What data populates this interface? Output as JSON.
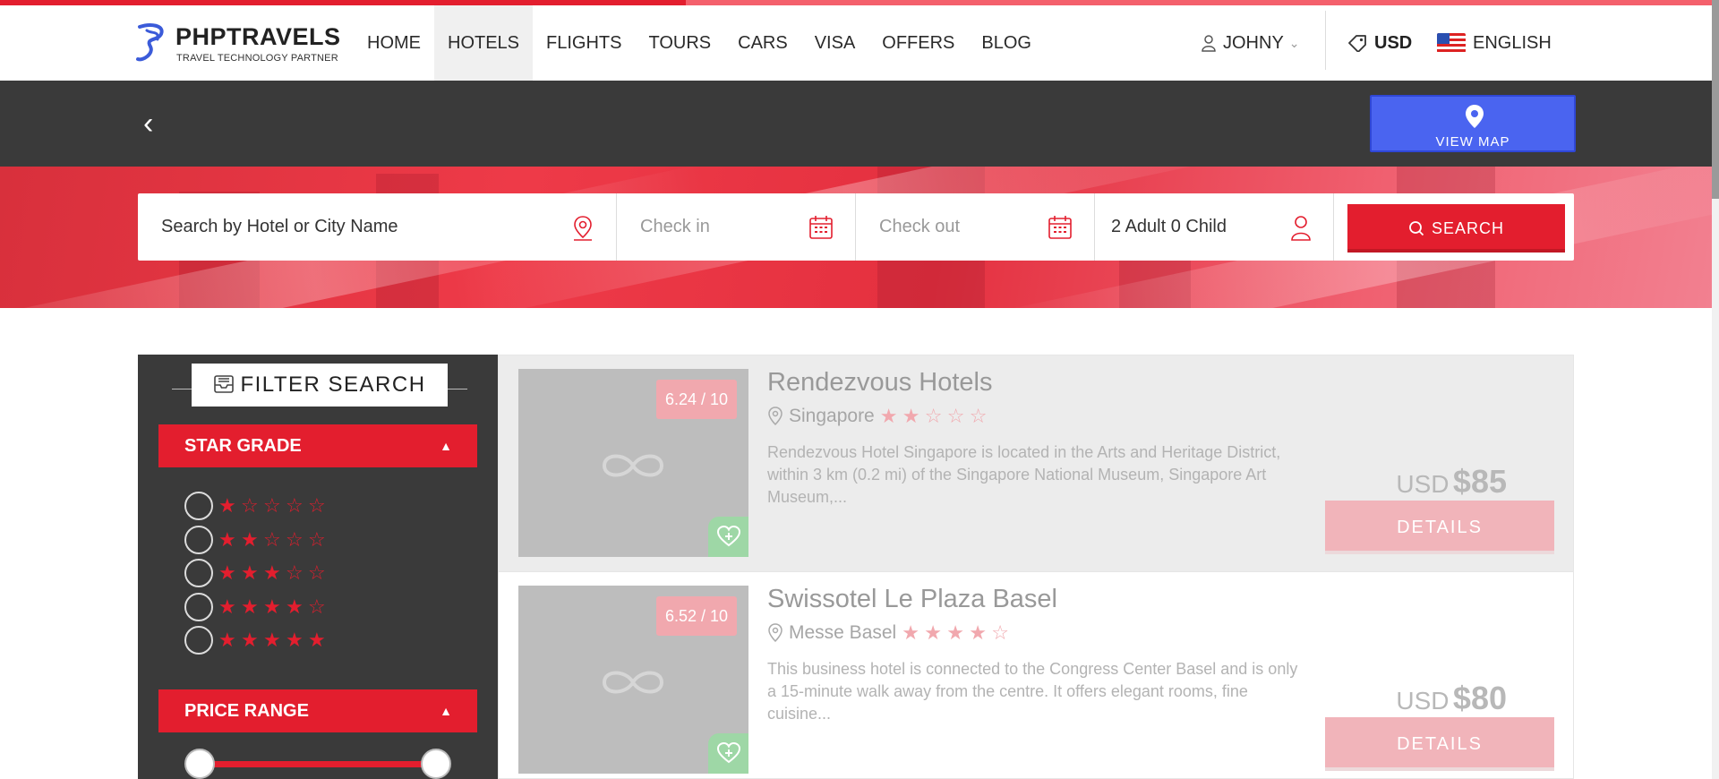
{
  "topbar": {
    "progress_percent": 40
  },
  "header": {
    "brand": "PHPTRAVELS",
    "tagline": "TRAVEL TECHNOLOGY PARTNER",
    "nav": [
      "HOME",
      "HOTELS",
      "FLIGHTS",
      "TOURS",
      "CARS",
      "VISA",
      "OFFERS",
      "BLOG"
    ],
    "active_nav": "HOTELS",
    "user": "JOHNY",
    "currency": "USD",
    "language": "ENGLISH"
  },
  "subheader": {
    "back_icon": "chevron-left-icon",
    "view_map_label": "VIEW MAP"
  },
  "search": {
    "destination_placeholder": "Search by Hotel or City Name",
    "checkin_placeholder": "Check in",
    "checkout_placeholder": "Check out",
    "guests": "2 Adult 0 Child",
    "button_label": "SEARCH"
  },
  "filter": {
    "title": "FILTER SEARCH",
    "star_grade_label": "STAR GRADE",
    "star_options": [
      1,
      2,
      3,
      4,
      5
    ],
    "price_range_label": "PRICE RANGE"
  },
  "hotels": [
    {
      "name": "Rendezvous Hotels",
      "location": "Singapore",
      "stars": 2,
      "rating": "6.24 / 10",
      "description": "Rendezvous Hotel Singapore is located in the Arts and Heritage District, within 3 km (0.2 mi) of the Singapore National Museum, Singapore Art Museum,...",
      "currency": "USD",
      "price": "$85",
      "details_label": "DETAILS"
    },
    {
      "name": "Swissotel Le Plaza Basel",
      "location": "Messe Basel",
      "stars": 4,
      "rating": "6.52 / 10",
      "description": "This business hotel is connected to the Congress Center Basel and is only a 15-minute walk away from the centre. It offers elegant rooms, fine cuisine...",
      "currency": "USD",
      "price": "$80",
      "details_label": "DETAILS"
    }
  ],
  "colors": {
    "accent": "#e31e2e",
    "dark": "#3a3a3a",
    "map_button": "#4a64f0"
  }
}
